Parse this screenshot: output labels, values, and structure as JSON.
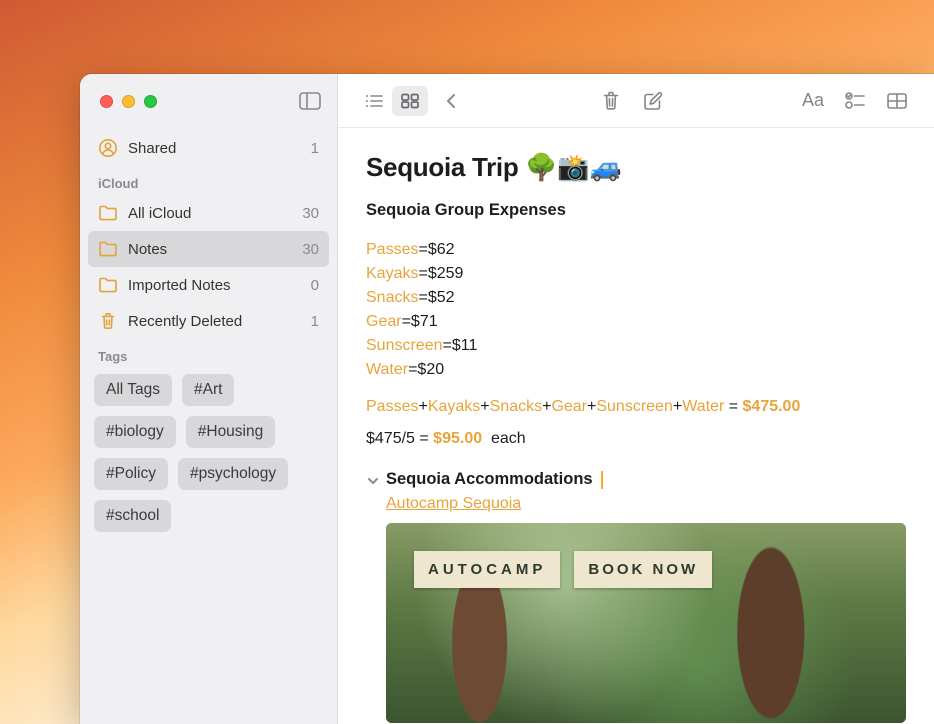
{
  "sidebar": {
    "shared": {
      "label": "Shared",
      "count": "1"
    },
    "section1": "iCloud",
    "items": [
      {
        "label": "All iCloud",
        "count": "30"
      },
      {
        "label": "Notes",
        "count": "30"
      },
      {
        "label": "Imported Notes",
        "count": "0"
      },
      {
        "label": "Recently Deleted",
        "count": "1"
      }
    ],
    "section2": "Tags",
    "tags": [
      "All Tags",
      "#Art",
      "#biology",
      "#Housing",
      "#Policy",
      "#psychology",
      "#school"
    ]
  },
  "note": {
    "title": "Sequoia Trip 🌳📸🚙",
    "subhead": "Sequoia Group Expenses",
    "expenses": [
      {
        "name": "Passes",
        "value": "$62"
      },
      {
        "name": "Kayaks",
        "value": "$259"
      },
      {
        "name": "Snacks",
        "value": "$52"
      },
      {
        "name": "Gear",
        "value": "$71"
      },
      {
        "name": "Sunscreen",
        "value": "$11"
      },
      {
        "name": "Water",
        "value": "$20"
      }
    ],
    "sum_items": [
      "Passes",
      "Kayaks",
      "Snacks",
      "Gear",
      "Sunscreen",
      "Water"
    ],
    "sum_total": "$475.00",
    "each_prefix": "$475/5",
    "each_value": "$95.00",
    "each_suffix": "each",
    "acc_head": "Sequoia Accommodations",
    "acc_link": "Autocamp Sequoia",
    "attach": {
      "chip1": "AUTOCAMP",
      "chip2": "BOOK NOW"
    }
  }
}
